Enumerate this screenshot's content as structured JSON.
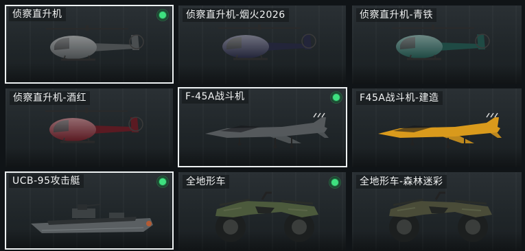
{
  "vehicles": [
    {
      "name": "侦察直升机",
      "kind": "helicopter",
      "color": "#4a4e50",
      "owned": true,
      "selected": true
    },
    {
      "name": "侦察直升机-烟火2026",
      "kind": "helicopter",
      "color": "#23253a",
      "owned": false,
      "selected": false
    },
    {
      "name": "侦察直升机-青铁",
      "kind": "helicopter",
      "color": "#1f4a44",
      "owned": false,
      "selected": false
    },
    {
      "name": "侦察直升机-酒红",
      "kind": "helicopter",
      "color": "#5a1a22",
      "owned": false,
      "selected": false
    },
    {
      "name": "F-45A战斗机",
      "kind": "jet",
      "color": "#55595c",
      "owned": true,
      "selected": true
    },
    {
      "name": "F45A战斗机-建造",
      "kind": "jet",
      "color": "#d99a1c",
      "owned": false,
      "selected": false
    },
    {
      "name": "UCB-95攻击艇",
      "kind": "boat",
      "color": "#5a5f62",
      "owned": true,
      "selected": true
    },
    {
      "name": "全地形车",
      "kind": "atv",
      "color": "#4c5a3c",
      "owned": true,
      "selected": false
    },
    {
      "name": "全地形车-森林迷彩",
      "kind": "atv",
      "color": "#4a4c38",
      "owned": false,
      "selected": false
    }
  ],
  "icons": {
    "owned_badge": "green-dot-icon"
  },
  "colors": {
    "owned": "#3ee07f",
    "selection_border": "#eef2f3",
    "label_text": "#f2f4f4"
  }
}
